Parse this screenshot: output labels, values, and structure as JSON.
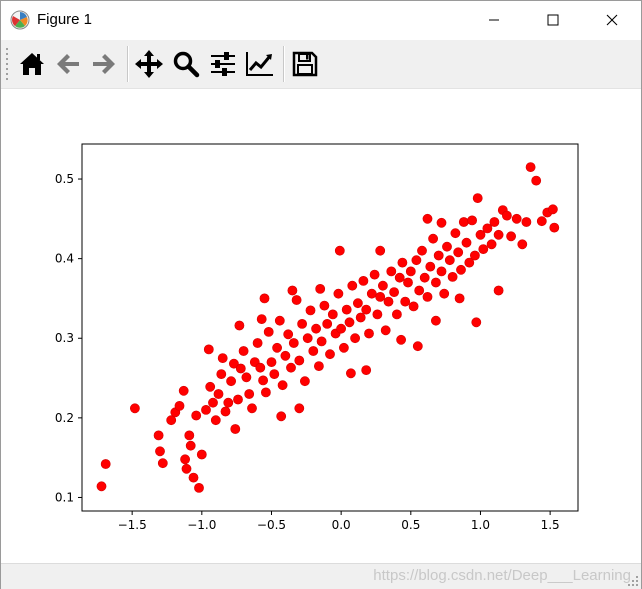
{
  "window": {
    "title": "Figure 1"
  },
  "toolbar": {
    "tools": [
      {
        "id": "home",
        "icon": "home-icon"
      },
      {
        "id": "back",
        "icon": "arrow-left-icon"
      },
      {
        "id": "forward",
        "icon": "arrow-right-icon"
      },
      {
        "id": "pan",
        "icon": "move-icon"
      },
      {
        "id": "zoom",
        "icon": "magnifier-icon"
      },
      {
        "id": "subplots",
        "icon": "sliders-icon"
      },
      {
        "id": "edit",
        "icon": "line-chart-icon"
      },
      {
        "id": "save",
        "icon": "floppy-disk-icon"
      }
    ]
  },
  "statusbar": {
    "watermark": "https://blog.csdn.net/Deep___Learning"
  },
  "colors": {
    "marker": "#ff0000",
    "marker_edge": "#d40000",
    "toolbar_bg": "#f0f0f0"
  },
  "chart_data": {
    "type": "scatter",
    "xlim": [
      -1.86,
      1.7
    ],
    "ylim": [
      0.083,
      0.544
    ],
    "xticks": [
      -1.5,
      -1.0,
      -0.5,
      0.0,
      0.5,
      1.0,
      1.5
    ],
    "xtick_labels": [
      "−1.5",
      "−1.0",
      "−0.5",
      "0.0",
      "0.5",
      "1.0",
      "1.5"
    ],
    "yticks": [
      0.1,
      0.2,
      0.3,
      0.4,
      0.5
    ],
    "ytick_labels": [
      "0.1",
      "0.2",
      "0.3",
      "0.4",
      "0.5"
    ],
    "title": "",
    "xlabel": "",
    "ylabel": "",
    "grid": false,
    "series": [
      {
        "color": "#ff0000",
        "points": [
          [
            -1.72,
            0.114
          ],
          [
            -1.69,
            0.142
          ],
          [
            -1.48,
            0.212
          ],
          [
            -1.31,
            0.178
          ],
          [
            -1.3,
            0.158
          ],
          [
            -1.28,
            0.143
          ],
          [
            -1.22,
            0.197
          ],
          [
            -1.19,
            0.207
          ],
          [
            -1.16,
            0.215
          ],
          [
            -1.13,
            0.234
          ],
          [
            -1.12,
            0.148
          ],
          [
            -1.11,
            0.136
          ],
          [
            -1.09,
            0.178
          ],
          [
            -1.08,
            0.165
          ],
          [
            -1.06,
            0.125
          ],
          [
            -1.04,
            0.203
          ],
          [
            -1.02,
            0.112
          ],
          [
            -1.0,
            0.154
          ],
          [
            -0.97,
            0.21
          ],
          [
            -0.94,
            0.239
          ],
          [
            -0.92,
            0.219
          ],
          [
            -0.9,
            0.197
          ],
          [
            -0.88,
            0.23
          ],
          [
            -0.86,
            0.255
          ],
          [
            -0.85,
            0.275
          ],
          [
            -0.83,
            0.208
          ],
          [
            -0.81,
            0.219
          ],
          [
            -0.79,
            0.246
          ],
          [
            -0.77,
            0.268
          ],
          [
            -0.76,
            0.186
          ],
          [
            -0.74,
            0.223
          ],
          [
            -0.72,
            0.262
          ],
          [
            -0.7,
            0.284
          ],
          [
            -0.68,
            0.251
          ],
          [
            -0.66,
            0.23
          ],
          [
            -0.64,
            0.212
          ],
          [
            -0.62,
            0.27
          ],
          [
            -0.6,
            0.294
          ],
          [
            -0.58,
            0.263
          ],
          [
            -0.56,
            0.247
          ],
          [
            -0.54,
            0.232
          ],
          [
            -0.52,
            0.308
          ],
          [
            -0.5,
            0.27
          ],
          [
            -0.48,
            0.255
          ],
          [
            -0.46,
            0.288
          ],
          [
            -0.44,
            0.322
          ],
          [
            -0.42,
            0.241
          ],
          [
            -0.4,
            0.278
          ],
          [
            -0.38,
            0.305
          ],
          [
            -0.36,
            0.263
          ],
          [
            -0.34,
            0.294
          ],
          [
            -0.32,
            0.348
          ],
          [
            -0.3,
            0.272
          ],
          [
            -0.28,
            0.318
          ],
          [
            -0.26,
            0.246
          ],
          [
            -0.24,
            0.3
          ],
          [
            -0.22,
            0.335
          ],
          [
            -0.2,
            0.284
          ],
          [
            -0.18,
            0.312
          ],
          [
            -0.16,
            0.265
          ],
          [
            -0.14,
            0.296
          ],
          [
            -0.12,
            0.341
          ],
          [
            -0.1,
            0.318
          ],
          [
            -0.08,
            0.28
          ],
          [
            -0.06,
            0.33
          ],
          [
            -0.04,
            0.306
          ],
          [
            -0.02,
            0.356
          ],
          [
            0.0,
            0.312
          ],
          [
            0.02,
            0.288
          ],
          [
            0.04,
            0.336
          ],
          [
            0.06,
            0.32
          ],
          [
            0.08,
            0.366
          ],
          [
            0.1,
            0.3
          ],
          [
            0.12,
            0.344
          ],
          [
            0.14,
            0.326
          ],
          [
            0.16,
            0.372
          ],
          [
            0.18,
            0.336
          ],
          [
            0.2,
            0.306
          ],
          [
            0.22,
            0.356
          ],
          [
            0.24,
            0.38
          ],
          [
            0.26,
            0.33
          ],
          [
            0.28,
            0.352
          ],
          [
            0.3,
            0.366
          ],
          [
            0.32,
            0.31
          ],
          [
            0.34,
            0.346
          ],
          [
            0.36,
            0.384
          ],
          [
            0.38,
            0.358
          ],
          [
            0.4,
            0.33
          ],
          [
            0.42,
            0.376
          ],
          [
            0.44,
            0.395
          ],
          [
            0.46,
            0.346
          ],
          [
            0.48,
            0.37
          ],
          [
            0.5,
            0.384
          ],
          [
            0.52,
            0.34
          ],
          [
            0.54,
            0.398
          ],
          [
            0.56,
            0.36
          ],
          [
            0.58,
            0.41
          ],
          [
            0.6,
            0.376
          ],
          [
            0.62,
            0.352
          ],
          [
            0.64,
            0.39
          ],
          [
            0.66,
            0.425
          ],
          [
            0.68,
            0.37
          ],
          [
            0.7,
            0.404
          ],
          [
            0.72,
            0.384
          ],
          [
            0.74,
            0.356
          ],
          [
            0.76,
            0.415
          ],
          [
            0.78,
            0.398
          ],
          [
            0.8,
            0.377
          ],
          [
            0.82,
            0.432
          ],
          [
            0.84,
            0.408
          ],
          [
            0.86,
            0.386
          ],
          [
            0.88,
            0.446
          ],
          [
            0.9,
            0.42
          ],
          [
            0.92,
            0.395
          ],
          [
            0.94,
            0.448
          ],
          [
            0.96,
            0.404
          ],
          [
            0.98,
            0.476
          ],
          [
            1.0,
            0.43
          ],
          [
            1.02,
            0.412
          ],
          [
            1.05,
            0.438
          ],
          [
            1.08,
            0.418
          ],
          [
            1.1,
            0.446
          ],
          [
            1.13,
            0.43
          ],
          [
            1.16,
            0.461
          ],
          [
            1.19,
            0.454
          ],
          [
            1.22,
            0.428
          ],
          [
            1.26,
            0.45
          ],
          [
            1.3,
            0.418
          ],
          [
            1.33,
            0.446
          ],
          [
            1.36,
            0.515
          ],
          [
            1.4,
            0.498
          ],
          [
            1.44,
            0.447
          ],
          [
            1.48,
            0.458
          ],
          [
            1.52,
            0.462
          ],
          [
            1.53,
            0.439
          ],
          [
            -0.95,
            0.286
          ],
          [
            -0.73,
            0.316
          ],
          [
            -0.57,
            0.324
          ],
          [
            -0.43,
            0.202
          ],
          [
            -0.3,
            0.212
          ],
          [
            -0.15,
            0.362
          ],
          [
            -0.01,
            0.41
          ],
          [
            0.07,
            0.256
          ],
          [
            0.18,
            0.26
          ],
          [
            0.28,
            0.41
          ],
          [
            0.43,
            0.298
          ],
          [
            0.55,
            0.29
          ],
          [
            0.68,
            0.322
          ],
          [
            0.72,
            0.445
          ],
          [
            0.85,
            0.35
          ],
          [
            0.97,
            0.32
          ],
          [
            1.13,
            0.36
          ],
          [
            -0.55,
            0.35
          ],
          [
            -0.35,
            0.36
          ],
          [
            0.62,
            0.45
          ]
        ]
      }
    ]
  }
}
